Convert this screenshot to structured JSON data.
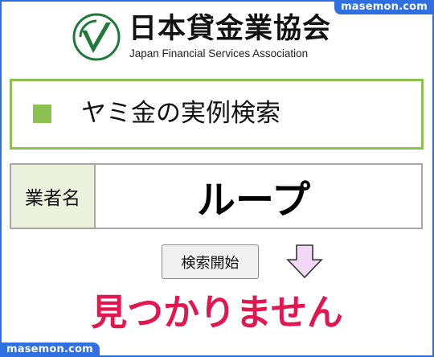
{
  "watermark": {
    "top": "masemon.com",
    "bottom": "masemon.com"
  },
  "logo": {
    "name_jp": "日本貸金業協会",
    "name_en": "Japan Financial Services Association",
    "mark_icon": "jfsa-checkmark-emblem"
  },
  "section": {
    "title": "ヤミ金の実例検索",
    "bullet_icon": "green-square-icon"
  },
  "search": {
    "field_label": "業者名",
    "field_value": "ループ",
    "button_label": "検索開始",
    "arrow_icon": "down-arrow-icon"
  },
  "result": {
    "message": "見つかりません"
  },
  "colors": {
    "accent_green": "#8cc152",
    "label_bg": "#ebf1dd",
    "result_red": "#e3174f",
    "watermark_blue": "#2f6fe0",
    "arrow_fill": "#f3d9f7"
  }
}
